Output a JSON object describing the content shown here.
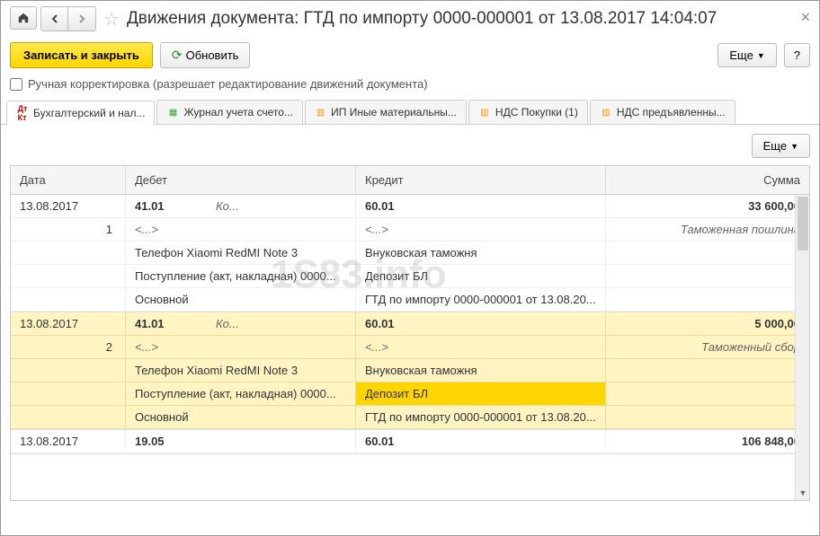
{
  "title": "Движения документа: ГТД по импорту 0000-000001 от 13.08.2017 14:04:07",
  "toolbar": {
    "save_close": "Записать и закрыть",
    "refresh": "Обновить",
    "more": "Еще",
    "help": "?"
  },
  "checkbox_label": "Ручная корректировка (разрешает редактирование движений документа)",
  "tabs": [
    {
      "label": "Бухгалтерский и нал...",
      "icon": "dk",
      "active": true
    },
    {
      "label": "Журнал учета счето...",
      "icon": "table"
    },
    {
      "label": "ИП Иные материальны...",
      "icon": "doc"
    },
    {
      "label": "НДС Покупки (1)",
      "icon": "doc"
    },
    {
      "label": "НДС предъявленны...",
      "icon": "doc"
    }
  ],
  "content_more": "Еще",
  "columns": {
    "date": "Дата",
    "debit": "Дебет",
    "credit": "Кредит",
    "sum": "Сумма"
  },
  "watermark": "1S83.info",
  "entries": [
    {
      "date": "13.08.2017",
      "num": "1",
      "debit_account": "41.01",
      "debit_kol": "Ко...",
      "credit_account": "60.01",
      "sum": "33 600,00",
      "sum_desc": "Таможенная пошлина",
      "debit_lines": [
        "<...>",
        "Телефон Xiaomi RedMI Note 3",
        "Поступление (акт, накладная) 0000...",
        "Основной"
      ],
      "credit_lines": [
        "<...>",
        "Внуковская таможня",
        "Депозит БЛ",
        "ГТД по импорту 0000-000001 от 13.08.20..."
      ]
    },
    {
      "date": "13.08.2017",
      "num": "2",
      "debit_account": "41.01",
      "debit_kol": "Ко...",
      "credit_account": "60.01",
      "sum": "5 000,00",
      "sum_desc": "Таможенный сбор",
      "debit_lines": [
        "<...>",
        "Телефон Xiaomi RedMI Note 3",
        "Поступление (акт, накладная) 0000...",
        "Основной"
      ],
      "credit_lines": [
        "<...>",
        "Внуковская таможня",
        "Депозит БЛ",
        "ГТД по импорту 0000-000001 от 13.08.20..."
      ],
      "highlight": true,
      "selected_credit_idx": 2
    },
    {
      "date": "13.08.2017",
      "num": "",
      "debit_account": "19.05",
      "debit_kol": "",
      "credit_account": "60.01",
      "sum": "106 848,00",
      "sum_desc": "",
      "debit_lines": [],
      "credit_lines": []
    }
  ]
}
